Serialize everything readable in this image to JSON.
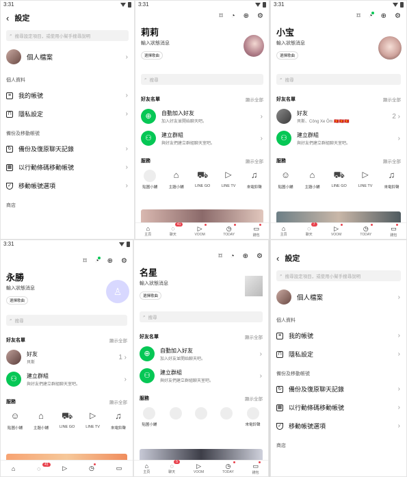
{
  "status": {
    "time": "3:31"
  },
  "settings": {
    "title": "設定",
    "search_placeholder": "搜尋設定項目，或使用小幫手搜尋說明",
    "profile": "個人檔案",
    "personal_section": "個人資料",
    "my_account": "我的帳號",
    "privacy": "隱私設定",
    "backup_section": "備份及移動帳號",
    "backup": "備份及復原聊天記錄",
    "migrate": "以行動條碼移動帳號",
    "migrate_options": "移動帳號選項",
    "store_section": "商店"
  },
  "home": {
    "status_message": "輸入狀態消息",
    "bgm_tag": "選擇歌曲",
    "search_placeholder": "搜尋",
    "friends_header": "好友名單",
    "show_all": "顯示全部",
    "auto_add": "自動加入好友",
    "auto_add_desc": "加入好友並開始聊天吧。",
    "create_group": "建立群組",
    "create_group_desc": "與好友們建立群組聊天室吧。",
    "services_header": "服務",
    "services": [
      "貼圖小舖",
      "主題小舖",
      "LINE GO",
      "LINE TV",
      "來電鈴聲"
    ],
    "nav": [
      "主頁",
      "聊天",
      "VOOM",
      "TODAY",
      "錢包"
    ],
    "chat_badge": "41",
    "chat_badge_b": "7",
    "chat_badge_c": "41",
    "chat_badge_d": "5"
  },
  "users": {
    "lili": "莉莉",
    "xiaobao": "小宝",
    "yongsheng": "永勝",
    "mingxing": "名星"
  },
  "friend_row": {
    "label": "好友",
    "sub_xiaobao": "貝斯、Công Xe Ôm 🇻🇳🇻🇳🇻🇳",
    "count": "2",
    "sub_yongsheng": "貝斯",
    "count_b": "1"
  },
  "colors": {
    "accent": "#06c755",
    "badge": "#e8424d"
  }
}
